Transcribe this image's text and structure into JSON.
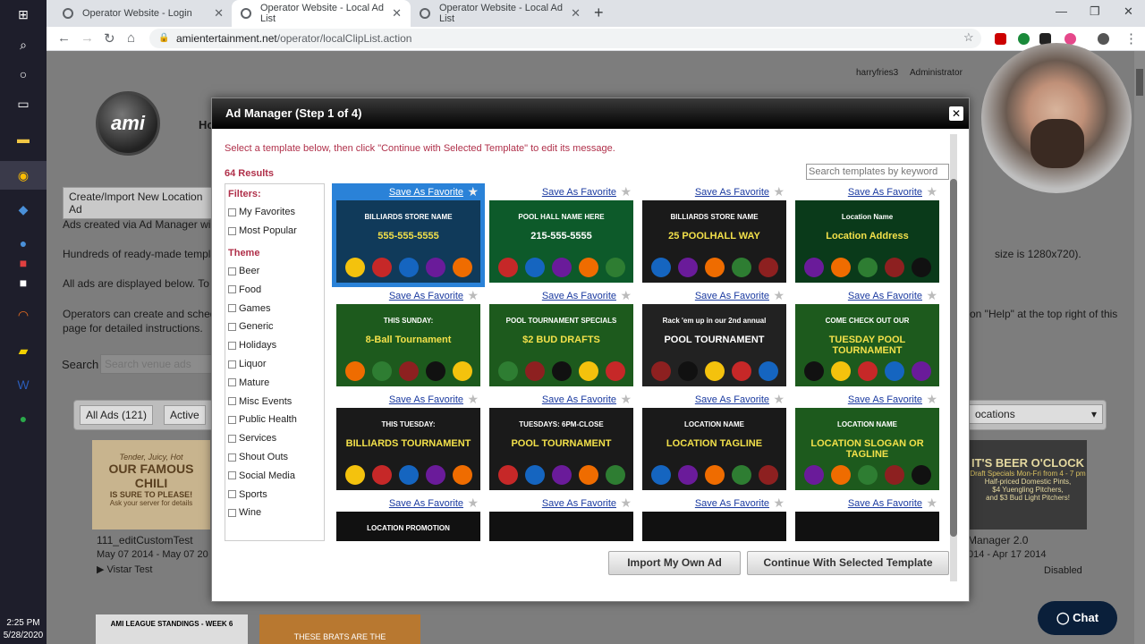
{
  "taskbar": {
    "time": "2:25 PM",
    "date": "5/28/2020"
  },
  "browser": {
    "tabs": [
      {
        "label": "Operator Website - Login"
      },
      {
        "label": "Operator Website - Local Ad List"
      },
      {
        "label": "Operator Website - Local Ad List"
      }
    ],
    "url_host": "amientertainment.net",
    "url_path": "/operator/localClipList.action"
  },
  "page": {
    "user": "harryfries3",
    "role": "Administrator",
    "create_button": "Create/Import New Location Ad",
    "para1": "Ads created via Ad Manager will",
    "para2": "Hundreds of ready-made templa",
    "para2_tail": "size is 1280x720).",
    "para3": "All ads are displayed below. To e",
    "para4": "Operators can create and sched",
    "para4_tail": "on \"Help\" at the top right of this",
    "para4b": "page for detailed instructions.",
    "search_label": "Search",
    "search_placeholder": "Search venue ads",
    "tab_all": "All Ads (121)",
    "tab_active": "Active",
    "locations_select": "ocations",
    "card1_title": "111_editCustomTest",
    "card1_dates": "May 07 2014 - May 07 20",
    "card1_loc": "Vistar Test",
    "card1_thumb": [
      "Tender, Juicy, Hot",
      "OUR FAMOUS CHILI",
      "IS SURE TO PLEASE!",
      "Ask your server for details"
    ],
    "card2_title": "Manager 2.0",
    "card2_dates": "014 - Apr 17 2014",
    "card2_status": "Disabled",
    "card2_thumb": [
      "IT'S BEER O'CLOCK",
      "Draft Specials Mon-Fri from 4 - 7 pm",
      "Half-priced Domestic Pints,",
      "$4 Yuengling Pitchers,",
      "and $3 Bud Light Pitchers!"
    ],
    "card3_thumb": "AMI LEAGUE STANDINGS - WEEK 6",
    "card4_thumb": "THESE BRATS ARE THE"
  },
  "modal": {
    "title": "Ad Manager (Step 1 of 4)",
    "instruction": "Select a template below, then click \"Continue with Selected Template\" to edit its message.",
    "results": "64 Results",
    "search_placeholder": "Search templates by keyword",
    "filters_label": "Filters:",
    "filters": [
      "My Favorites",
      "Most Popular"
    ],
    "theme_label": "Theme",
    "themes": [
      "Beer",
      "Food",
      "Games",
      "Generic",
      "Holidays",
      "Liquor",
      "Mature",
      "Misc Events",
      "Public Health",
      "Services",
      "Shout Outs",
      "Social Media",
      "Sports",
      "Wine"
    ],
    "favorite_label": "Save As Favorite",
    "templates": [
      {
        "line1": "BILLIARDS STORE NAME",
        "line2": "555-555-5555",
        "bg": "#103a5a"
      },
      {
        "line1": "POOL HALL NAME HERE",
        "line2": "215-555-5555",
        "bg": "#0d5a2a"
      },
      {
        "line1": "BILLIARDS STORE NAME",
        "line2": "25 POOLHALL WAY",
        "bg": "#1a1a1a"
      },
      {
        "line1": "Location Name",
        "line2": "Location Address",
        "bg": "#0a3a1a"
      },
      {
        "line1": "THIS SUNDAY:",
        "line2": "8-Ball Tournament",
        "bg": "#1d5a1d"
      },
      {
        "line1": "POOL TOURNAMENT SPECIALS",
        "line2": "$2 BUD DRAFTS",
        "bg": "#1d5a1d"
      },
      {
        "line1": "Rack 'em up in our 2nd annual",
        "line2": "POOL TOURNAMENT",
        "bg": "#222"
      },
      {
        "line1": "COME CHECK OUT OUR",
        "line2": "TUESDAY POOL TOURNAMENT",
        "bg": "#1d5a1d"
      },
      {
        "line1": "THIS TUESDAY:",
        "line2": "BILLIARDS TOURNAMENT",
        "bg": "#1a1a1a"
      },
      {
        "line1": "TUESDAYS: 6PM-CLOSE",
        "line2": "POOL TOURNAMENT",
        "bg": "#1a1a1a"
      },
      {
        "line1": "LOCATION NAME",
        "line2": "LOCATION TAGLINE",
        "bg": "#1a1a1a"
      },
      {
        "line1": "LOCATION NAME",
        "line2": "LOCATION SLOGAN OR TAGLINE",
        "bg": "#1d5a1d"
      },
      {
        "line1": "LOCATION PROMOTION",
        "line2": "",
        "bg": "#111"
      },
      {
        "line1": "",
        "line2": "",
        "bg": "#111"
      },
      {
        "line1": "",
        "line2": "",
        "bg": "#111"
      },
      {
        "line1": "",
        "line2": "",
        "bg": "#111"
      }
    ],
    "import_button": "Import My Own Ad",
    "continue_button": "Continue With Selected Template"
  },
  "chat": {
    "label": "Chat"
  },
  "colors": {
    "accent": "#b0304a",
    "selected": "#2a82d8",
    "link": "#1a3aa0"
  }
}
